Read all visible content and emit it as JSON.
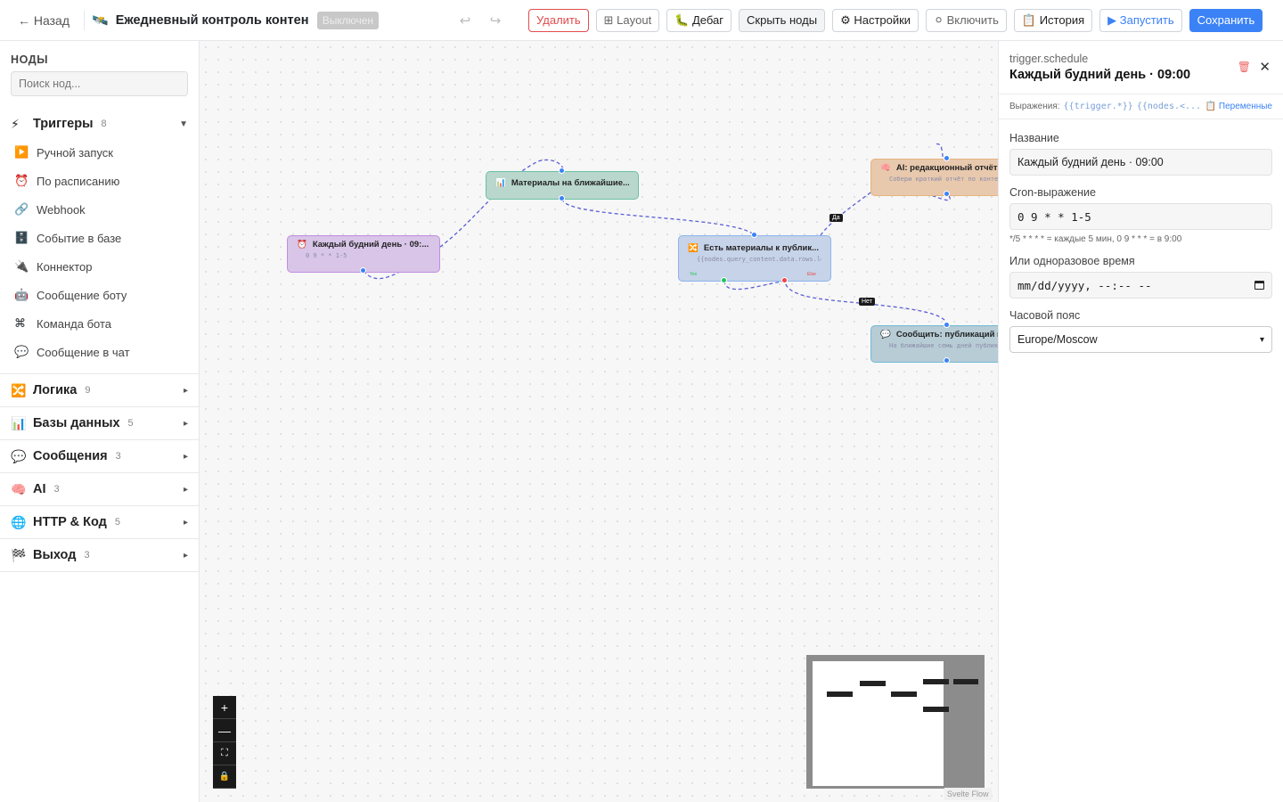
{
  "toolbar": {
    "back_label": "← Назад",
    "workflow_icon": "🛰️",
    "workflow_title": "Ежедневный контроль контен",
    "status": "Выключен",
    "undo": "↩",
    "redo": "↪",
    "buttons": {
      "delete": "Удалить",
      "layout": "⊞ Layout",
      "debug": "🐛 Дебаг",
      "hide_nodes": "Скрыть ноды",
      "settings": "⚙ Настройки",
      "enable": "⚪ Включить",
      "history": "📋 История",
      "run": "▶ Запустить",
      "save": "Сохранить"
    }
  },
  "sidebar": {
    "title": "НОДЫ",
    "search_placeholder": "Поиск нод...",
    "first_category": {
      "icon": "⚡",
      "name": "Триггеры",
      "count": "8",
      "arrow": "▼"
    },
    "trigger_items": [
      {
        "icon": "▶️",
        "label": "Ручной запуск"
      },
      {
        "icon": "⏰",
        "label": "По расписанию"
      },
      {
        "icon": "🔗",
        "label": "Webhook"
      },
      {
        "icon": "🗄️",
        "label": "Событие в базе"
      },
      {
        "icon": "🔌",
        "label": "Коннектор"
      },
      {
        "icon": "🤖",
        "label": "Сообщение боту"
      },
      {
        "icon": "⌘",
        "label": "Команда бота"
      },
      {
        "icon": "💬",
        "label": "Сообщение в чат"
      }
    ],
    "categories": [
      {
        "icon": "🔀",
        "name": "Логика",
        "count": "9",
        "arrow": "▸"
      },
      {
        "icon": "📊",
        "name": "Базы данных",
        "count": "5",
        "arrow": "▸"
      },
      {
        "icon": "💬",
        "name": "Сообщения",
        "count": "3",
        "arrow": "▸"
      },
      {
        "icon": "🧠",
        "name": "AI",
        "count": "3",
        "arrow": "▸"
      },
      {
        "icon": "🌐",
        "name": "HTTP & Код",
        "count": "5",
        "arrow": "▸"
      },
      {
        "icon": "🏁",
        "name": "Выход",
        "count": "3",
        "arrow": "▸"
      }
    ]
  },
  "canvas": {
    "nodes": {
      "trigger": {
        "icon": "⏰",
        "title": "Каждый будний день · 09:...",
        "subtitle": "0 9 * * 1-5"
      },
      "db": {
        "icon": "📊",
        "title": "Материалы на ближайшие...",
        "subtitle": ""
      },
      "logic": {
        "icon": "🔀",
        "title": "Есть материалы к публик...",
        "subtitle": "{{nodes.query_content.data.rows.len"
      },
      "ai": {
        "icon": "🧠",
        "title": "AI: редакционный отчёт",
        "subtitle": "Собери краткий отчёт по контент"
      },
      "msg": {
        "icon": "💬",
        "title": "Сообщить: публикаций не",
        "subtitle": "На ближайшие семь дней публикац"
      }
    },
    "edge_labels": {
      "yes": "Да",
      "no": "Нет"
    },
    "ports": {
      "yes": "Yes",
      "no": "Else"
    },
    "zoom": {
      "in": "+",
      "out": "—",
      "fit": "⛶",
      "lock": "🔒"
    },
    "attribution": "Svelte Flow"
  },
  "panel": {
    "node_type": "trigger.schedule",
    "title": "Каждый будний день · 09:00",
    "delete_icon": "🗑",
    "close_icon": "✕",
    "expr_label": "Выражения:",
    "expr_token1": "{{trigger.*}}",
    "expr_token2": "{{nodes.<...",
    "vars_label": "📋 Переменные",
    "fields": {
      "name_label": "Название",
      "name_value": "Каждый будний день · 09:00",
      "cron_label": "Cron-выражение",
      "cron_value": "0 9 * * 1-5",
      "cron_hint": "*/5 * * * * = каждые 5 мин, 0 9 * * * = в 9:00",
      "once_label": "Или одноразовое время",
      "once_value": "mm/dd/yyyy, --:-- --",
      "tz_label": "Часовой пояс",
      "tz_value": "Europe/Moscow"
    }
  },
  "colors": {
    "accent": "#3b82f6",
    "danger": "#e24c4c"
  }
}
